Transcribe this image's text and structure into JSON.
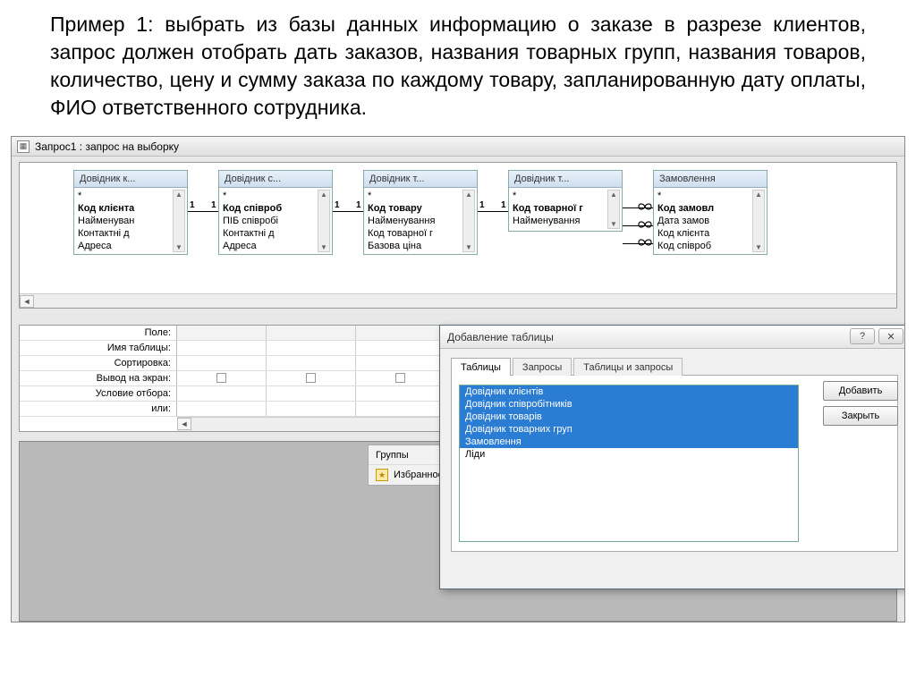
{
  "problem_text": "Пример 1: выбрать из базы данных информацию о заказе в разрезе клиентов, запрос должен отобрать дать заказов, названия товарных групп, названия товаров, количество, цену и сумму заказа по каждому товару, запланированную дату оплаты, ФИО ответственного сотрудника.",
  "window": {
    "title": "Запрос1 : запрос на выборку"
  },
  "tables": [
    {
      "title": "Довідник к...",
      "fields": [
        "*",
        "Код клієнта",
        "Найменуван",
        "Контактні д",
        "Адреса"
      ],
      "bold_index": 1
    },
    {
      "title": "Довідник с...",
      "fields": [
        "*",
        "Код співроб",
        "ПІБ співробі",
        "Контактні д",
        "Адреса"
      ],
      "bold_index": 1
    },
    {
      "title": "Довідник т...",
      "fields": [
        "*",
        "Код товару",
        "Найменування",
        "Код товарної г",
        "Базова ціна"
      ],
      "bold_index": 1
    },
    {
      "title": "Довідник т...",
      "fields": [
        "*",
        "Код товарної г",
        "Найменування"
      ],
      "bold_index": 1
    },
    {
      "title": "Замовлення",
      "fields": [
        "*",
        "Код замовл",
        "Дата замов",
        "Код клієнта",
        "Код співроб"
      ],
      "bold_index": 1
    }
  ],
  "grid_labels": [
    "Поле:",
    "Имя таблицы:",
    "Сортировка:",
    "Вывод на экран:",
    "Условие отбора:",
    "или:"
  ],
  "groups_panel": {
    "row1": "Группы",
    "row2": "Избранное"
  },
  "dialog": {
    "title": "Добавление таблицы",
    "tabs": [
      "Таблицы",
      "Запросы",
      "Таблицы и запросы"
    ],
    "items": [
      "Довідник клієнтів",
      "Довідник співробітників",
      "Довідник товарів",
      "Довідник товарних груп",
      "Замовлення",
      "Ліди"
    ],
    "selected_to": 4,
    "add": "Добавить",
    "close": "Закрыть",
    "help_title": "?",
    "x_title": "✕"
  }
}
